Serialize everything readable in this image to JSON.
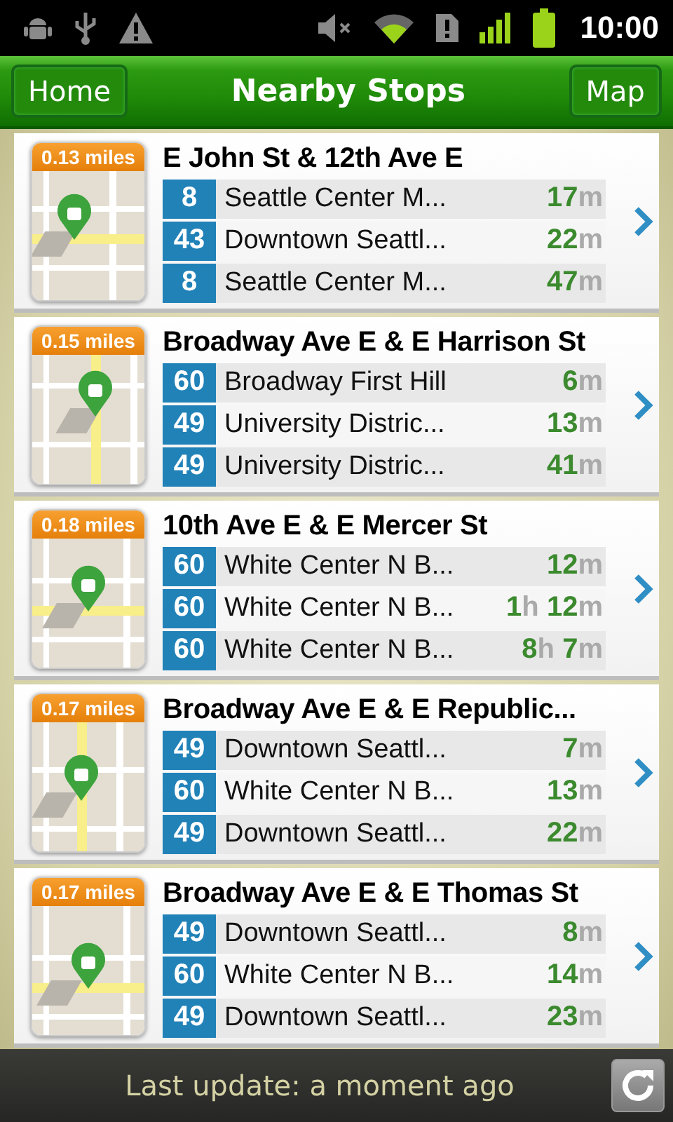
{
  "status_bar": {
    "time": "10:00"
  },
  "header": {
    "title": "Nearby Stops",
    "left_button": "Home",
    "right_button": "Map"
  },
  "stops": [
    {
      "distance": "0.13 miles",
      "name": "E John St & 12th Ave E",
      "arrivals": [
        {
          "route": "8",
          "destination": "Seattle Center M...",
          "time": [
            {
              "value": "17",
              "unit": "m"
            }
          ]
        },
        {
          "route": "43",
          "destination": "Downtown Seattl...",
          "time": [
            {
              "value": "22",
              "unit": "m"
            }
          ]
        },
        {
          "route": "8",
          "destination": "Seattle Center M...",
          "time": [
            {
              "value": "47",
              "unit": "m"
            }
          ]
        }
      ]
    },
    {
      "distance": "0.15 miles",
      "name": "Broadway Ave E & E Harrison St",
      "arrivals": [
        {
          "route": "60",
          "destination": "Broadway First Hill",
          "time": [
            {
              "value": "6",
              "unit": "m"
            }
          ]
        },
        {
          "route": "49",
          "destination": "University Distric...",
          "time": [
            {
              "value": "13",
              "unit": "m"
            }
          ]
        },
        {
          "route": "49",
          "destination": "University Distric...",
          "time": [
            {
              "value": "41",
              "unit": "m"
            }
          ]
        }
      ]
    },
    {
      "distance": "0.18 miles",
      "name": "10th Ave E & E Mercer St",
      "arrivals": [
        {
          "route": "60",
          "destination": "White Center N B...",
          "time": [
            {
              "value": "12",
              "unit": "m"
            }
          ]
        },
        {
          "route": "60",
          "destination": "White Center N B...",
          "time": [
            {
              "value": "1",
              "unit": "h"
            },
            {
              "value": "12",
              "unit": "m"
            }
          ]
        },
        {
          "route": "60",
          "destination": "White Center N B...",
          "time": [
            {
              "value": "8",
              "unit": "h"
            },
            {
              "value": "7",
              "unit": "m"
            }
          ]
        }
      ]
    },
    {
      "distance": "0.17 miles",
      "name": "Broadway Ave E & E Republic...",
      "arrivals": [
        {
          "route": "49",
          "destination": "Downtown Seattl...",
          "time": [
            {
              "value": "7",
              "unit": "m"
            }
          ]
        },
        {
          "route": "60",
          "destination": "White Center N B...",
          "time": [
            {
              "value": "13",
              "unit": "m"
            }
          ]
        },
        {
          "route": "49",
          "destination": "Downtown Seattl...",
          "time": [
            {
              "value": "22",
              "unit": "m"
            }
          ]
        }
      ]
    },
    {
      "distance": "0.17 miles",
      "name": "Broadway Ave E & E Thomas St",
      "arrivals": [
        {
          "route": "49",
          "destination": "Downtown Seattl...",
          "time": [
            {
              "value": "8",
              "unit": "m"
            }
          ]
        },
        {
          "route": "60",
          "destination": "White Center N B...",
          "time": [
            {
              "value": "14",
              "unit": "m"
            }
          ]
        },
        {
          "route": "49",
          "destination": "Downtown Seattl...",
          "time": [
            {
              "value": "23",
              "unit": "m"
            }
          ]
        }
      ]
    }
  ],
  "footer": {
    "last_update": "Last update: a moment ago"
  }
}
